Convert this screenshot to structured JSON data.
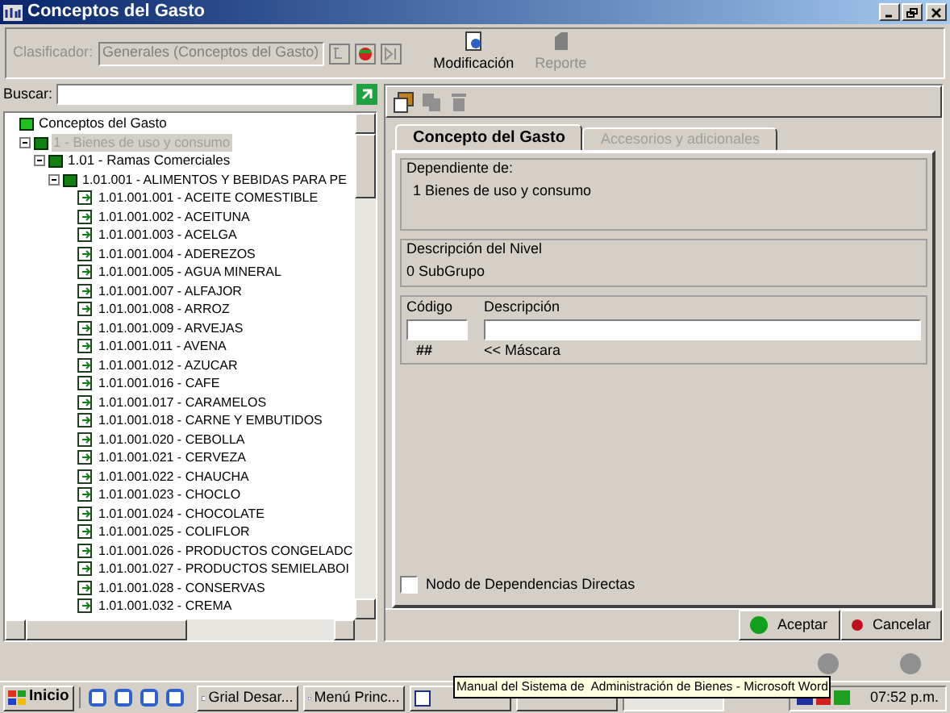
{
  "window": {
    "title": "Conceptos del Gasto"
  },
  "toolbar": {
    "classifier_label": "Clasificador:",
    "classifier_value": "Generales (Conceptos del Gasto)",
    "classifier_disabled": true,
    "buttons": [
      {
        "label": "Modificación",
        "disabled": false
      },
      {
        "label": "Reporte",
        "disabled": true
      }
    ]
  },
  "search": {
    "label": "Buscar:"
  },
  "tree": [
    {
      "label": "Conceptos del Gasto",
      "selected": false,
      "children": [
        {
          "label": "1 - Bienes de uso y consumo",
          "selected": true,
          "expanded": true,
          "children": [
            {
              "label": "1.01 - Ramas Comerciales",
              "selected": false,
              "expanded": true,
              "children": [
                {
                  "label": "1.01.001 - ALIMENTOS Y BEBIDAS PARA PE",
                  "selected": false,
                  "expanded": true,
                  "children": [
                    {
                      "label": "1.01.001.001 - ACEITE COMESTIBLE",
                      "selected": false
                    },
                    {
                      "label": "1.01.001.002 - ACEITUNA",
                      "selected": false
                    },
                    {
                      "label": "1.01.001.003 - ACELGA",
                      "selected": false
                    },
                    {
                      "label": "1.01.001.004 - ADEREZOS",
                      "selected": false
                    },
                    {
                      "label": "1.01.001.005 - AGUA MINERAL",
                      "selected": false
                    },
                    {
                      "label": "1.01.001.007 - ALFAJOR",
                      "selected": false
                    },
                    {
                      "label": "1.01.001.008 - ARROZ",
                      "selected": false
                    },
                    {
                      "label": "1.01.001.009 - ARVEJAS",
                      "selected": false
                    },
                    {
                      "label": "1.01.001.011 - AVENA",
                      "selected": false
                    },
                    {
                      "label": "1.01.001.012 - AZUCAR",
                      "selected": false
                    },
                    {
                      "label": "1.01.001.016 - CAFE",
                      "selected": false
                    },
                    {
                      "label": "1.01.001.017 - CARAMELOS",
                      "selected": false
                    },
                    {
                      "label": "1.01.001.018 - CARNE Y EMBUTIDOS",
                      "selected": false
                    },
                    {
                      "label": "1.01.001.020 - CEBOLLA",
                      "selected": false
                    },
                    {
                      "label": "1.01.001.021 - CERVEZA",
                      "selected": false
                    },
                    {
                      "label": "1.01.001.022 - CHAUCHA",
                      "selected": false
                    },
                    {
                      "label": "1.01.001.023 - CHOCLO",
                      "selected": false
                    },
                    {
                      "label": "1.01.001.024 - CHOCOLATE",
                      "selected": false
                    },
                    {
                      "label": "1.01.001.025 - COLIFLOR",
                      "selected": false
                    },
                    {
                      "label": "1.01.001.026 - PRODUCTOS CONGELADC",
                      "selected": false
                    },
                    {
                      "label": "1.01.001.027 - PRODUCTOS SEMIELABOI",
                      "selected": false
                    },
                    {
                      "label": "1.01.001.028 - CONSERVAS",
                      "selected": false
                    },
                    {
                      "label": "1.01.001.032 - CREMA",
                      "selected": false
                    }
                  ]
                }
              ]
            }
          ]
        }
      ]
    }
  ],
  "detail_toolbar": [
    {
      "kind": "new",
      "disabled": false
    },
    {
      "kind": "copy",
      "disabled": true
    },
    {
      "kind": "delete",
      "disabled": true
    }
  ],
  "tabs": [
    {
      "label": "Concepto del Gasto",
      "selected": true
    },
    {
      "label": "Accesorios y adicionales",
      "selected": false
    }
  ],
  "groups": [
    {
      "title": "Dependiente de:",
      "value": "1 Bienes de uso y consumo"
    },
    {
      "title": "Descripción del Nivel",
      "value": "0 SubGrupo"
    }
  ],
  "code_fields": {
    "code_label": "Código",
    "description_label": "Descripción",
    "mask": "##",
    "mask_hint": "<< Máscara"
  },
  "checkbox": {
    "label": "Nodo de Dependencias Directas",
    "checked": false
  },
  "actions": [
    {
      "label": "Aceptar",
      "color": "#10a020"
    },
    {
      "label": "Cancelar",
      "color": "#c01020"
    }
  ],
  "taskbar": {
    "start": "Inicio",
    "buttons": [
      {
        "label": "Grial Desar...",
        "active": false,
        "icon": true
      },
      {
        "label": "Menú Princ...",
        "active": false,
        "icon": true
      },
      {
        "active": false,
        "icon": true
      },
      {
        "active": false,
        "icon": false
      },
      {
        "active": true,
        "icon": false
      }
    ],
    "tooltip": "Manual del Sistema de  Administración de Bienes - Microsoft Word",
    "clock": "07:52 p.m."
  }
}
